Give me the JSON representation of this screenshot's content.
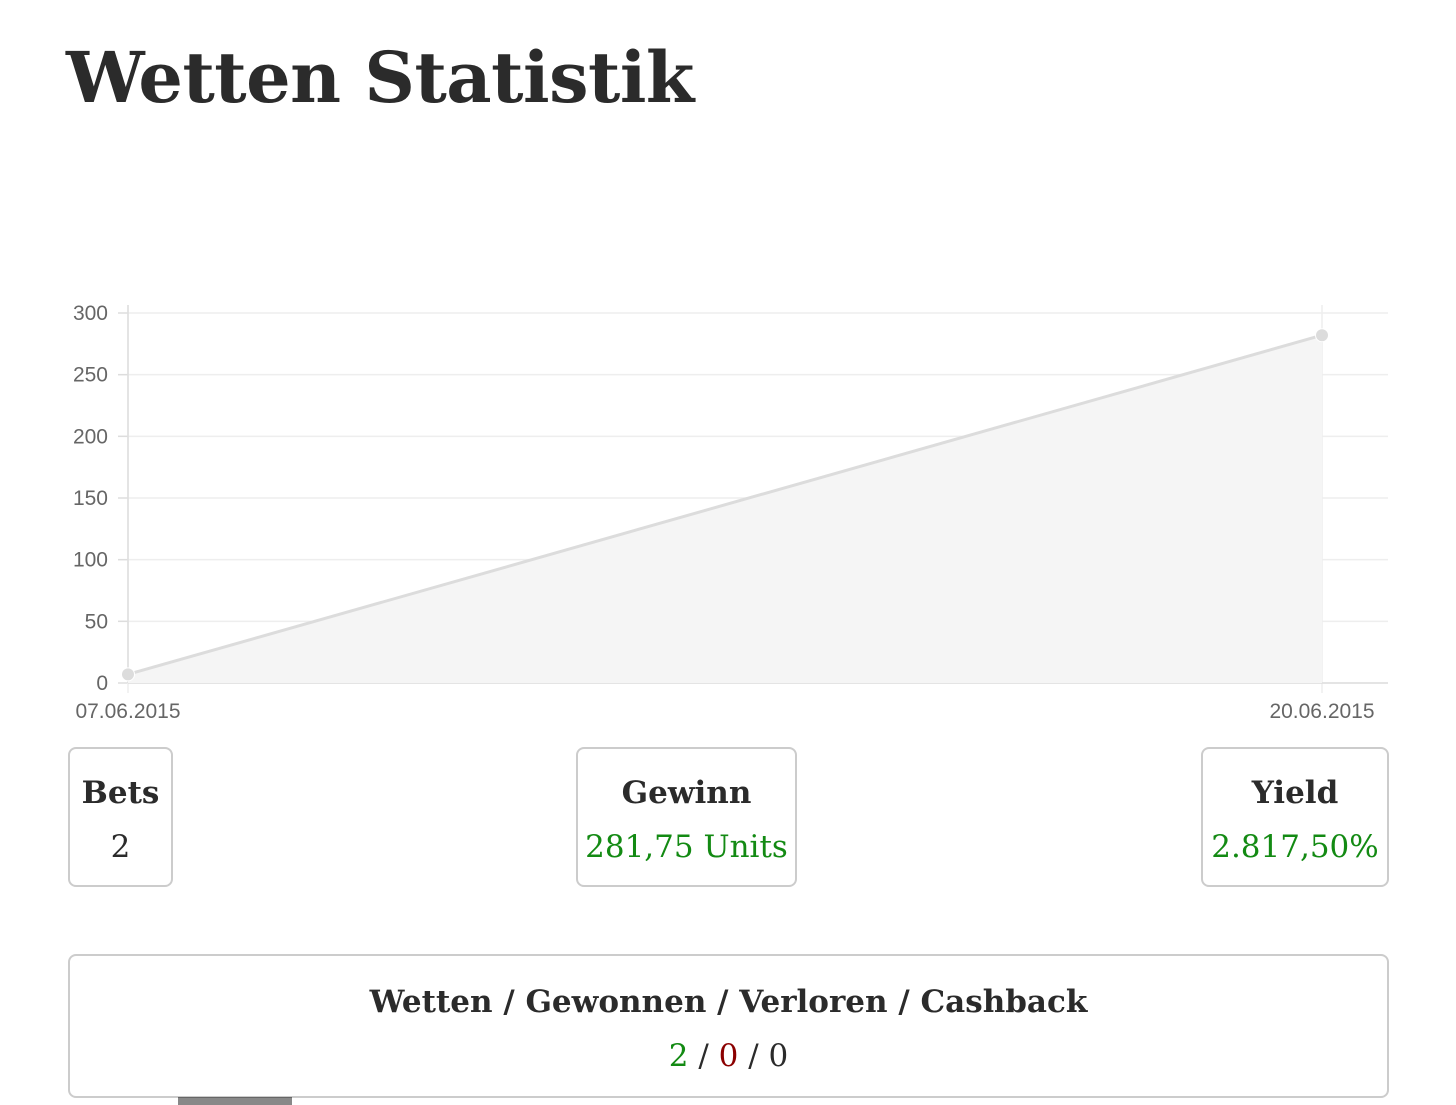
{
  "page": {
    "title": "Wetten Statistik"
  },
  "chart_data": {
    "type": "area",
    "x": [
      "07.06.2015",
      "20.06.2015"
    ],
    "series": [
      {
        "values": [
          7,
          282
        ]
      }
    ],
    "y_ticks": [
      0,
      50,
      100,
      150,
      200,
      250,
      300
    ],
    "ylim": [
      0,
      300
    ],
    "title": "",
    "xlabel": "",
    "ylabel": "",
    "grid": true,
    "colors": {
      "line": "#dcdcdc",
      "fill": "#f5f5f5",
      "grid": "#eeeeee",
      "axis": "#dddddd",
      "point": "#dcdcdc"
    }
  },
  "stats": {
    "bets": {
      "label": "Bets",
      "value": "2"
    },
    "gewinn": {
      "label": "Gewinn",
      "value": "281,75 Units"
    },
    "yield": {
      "label": "Yield",
      "value": "2.817,50%"
    }
  },
  "summary": {
    "label": "Wetten / Gewonnen / Verloren / Cashback",
    "wetten": "2",
    "gewonnen": "0",
    "verloren": "0",
    "separator": "/"
  },
  "colors": {
    "positive": "#138a13",
    "negative": "#8b0000",
    "text": "#2b2b2b",
    "border": "#cccccc"
  }
}
